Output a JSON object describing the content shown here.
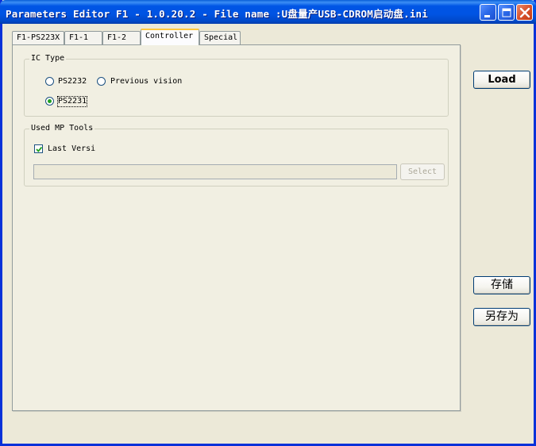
{
  "window": {
    "title": "Parameters Editor F1 - 1.0.20.2 - File name :U盘量产USB-CDROM启动盘.ini"
  },
  "tabs": [
    {
      "label": "F1-PS223X"
    },
    {
      "label": "F1-1"
    },
    {
      "label": "F1-2"
    },
    {
      "label": "Controller",
      "active": true
    },
    {
      "label": "Special"
    }
  ],
  "ic_type": {
    "legend": "IC Type",
    "options": [
      {
        "label": "PS2232",
        "selected": false
      },
      {
        "label": "Previous vision",
        "selected": false
      },
      {
        "label": "PS2231",
        "selected": true
      }
    ]
  },
  "mp_tools": {
    "legend": "Used MP Tools",
    "checkbox_label": "Last Versi",
    "checkbox_checked": true,
    "path_value": "",
    "select_label": "Select"
  },
  "buttons": {
    "load": "Load",
    "save": "存储",
    "save_as": "另存为"
  },
  "colors": {
    "titlebar": "#0054E3",
    "window_bg": "#ECE9D8",
    "tab_highlight": "#FFC83C",
    "radio_dot": "#21A121"
  },
  "icons": [
    "minimize-icon",
    "maximize-icon",
    "close-icon",
    "checkmark-icon"
  ]
}
